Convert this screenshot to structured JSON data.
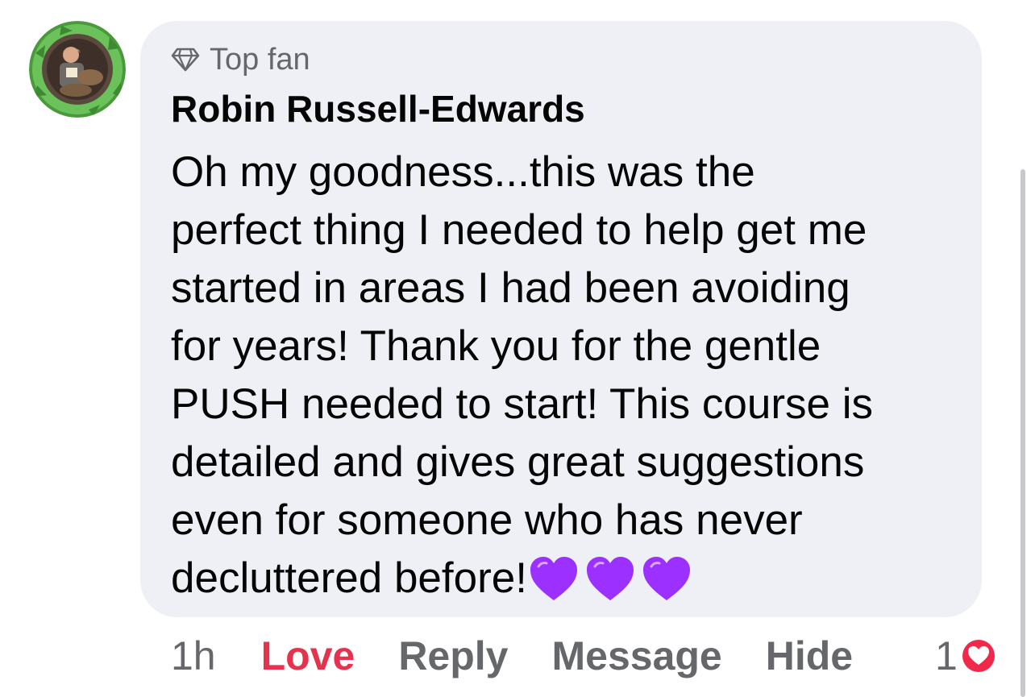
{
  "comment": {
    "badge_label": "Top fan",
    "author_name": "Robin Russell-Edwards",
    "text": "Oh my goodness...this was the\nperfect thing I needed to help get me\nstarted in areas I had been avoiding\nfor years! Thank you for the gentle\nPUSH needed to start! This course is\ndetailed and gives great suggestions\neven for someone who has never\ndecluttered before!",
    "emoji": [
      "purple-heart",
      "purple-heart",
      "purple-heart"
    ],
    "timestamp": "1h",
    "actions": {
      "love_label": "Love",
      "reply_label": "Reply",
      "message_label": "Message",
      "hide_label": "Hide"
    },
    "reaction_count": "1",
    "reaction_icon": "heart-reaction-icon"
  },
  "colors": {
    "bubble_background": "#eff0f5",
    "love_active": "#e5334e",
    "secondary_text": "#65676b",
    "primary_text": "#050505",
    "emoji_heart": "#9b30ff"
  }
}
